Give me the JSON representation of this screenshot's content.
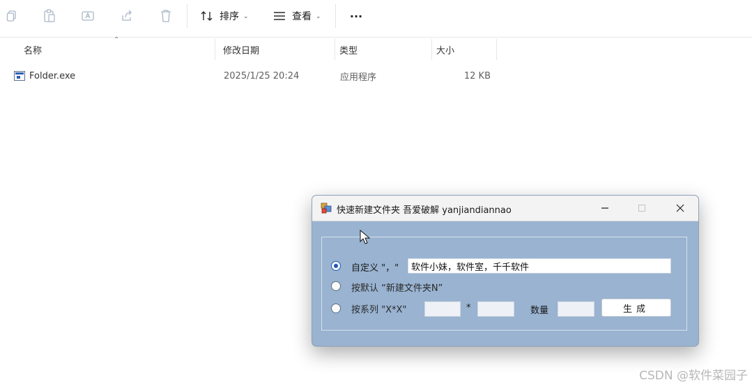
{
  "toolbar": {
    "sort_label": "排序",
    "view_label": "查看",
    "more_label": "···"
  },
  "columns": {
    "name": "名称",
    "modified": "修改日期",
    "type": "类型",
    "size": "大小"
  },
  "files": [
    {
      "name": "Folder.exe",
      "modified": "2025/1/25 20:24",
      "type": "应用程序",
      "size": "12 KB"
    }
  ],
  "dialog": {
    "title": "快速新建文件夹 吾爱破解 yanjiandiannao",
    "options": [
      {
        "label": "自定义 \"，\"",
        "checked": true
      },
      {
        "label": "按默认 “新建文件夹N”",
        "checked": false
      },
      {
        "label": "按系列 \"X*X\"",
        "checked": false
      }
    ],
    "custom_value": "软件小妹，软件室，千千软件",
    "multiply_symbol": "*",
    "quantity_label": "数量",
    "generate_label": "生成"
  },
  "watermark": "CSDN @软件菜园子"
}
